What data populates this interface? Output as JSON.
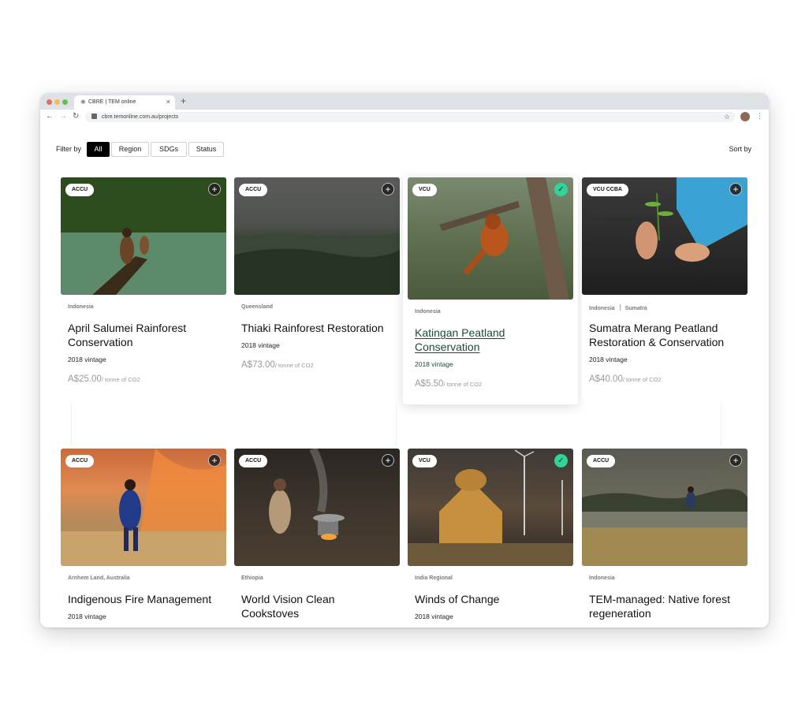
{
  "browser": {
    "tab_title": "CBRE | TEM online",
    "new_tab": "+",
    "tab_close": "×",
    "url": "cbre.temonline.com.au/projects"
  },
  "toolbar": {
    "filter_label": "Filter by",
    "filters": [
      "All",
      "Region",
      "SDGs",
      "Status"
    ],
    "active_filter": "All",
    "sort_label": "Sort by"
  },
  "projects": [
    {
      "badge": "ACCU",
      "region": "Indonesia",
      "subregion": "",
      "title": "April Salumei Rainforest Conservation",
      "vintage": "2018 vintage",
      "price": "A$25.00",
      "unit": "/ tonne of CO2",
      "status": "add"
    },
    {
      "badge": "ACCU",
      "region": "Queensland",
      "subregion": "",
      "title": "Thiaki Rainforest Restoration",
      "vintage": "2018 vintage",
      "price": "A$73.00",
      "unit": "/ tonne of CO2",
      "status": "add"
    },
    {
      "badge": "VCU",
      "region": "Indonesia",
      "subregion": "",
      "title": "Katingan Peatland Conservation",
      "vintage": "2018 vintage",
      "price": "A$5.50",
      "unit": "/ tonne of CO2",
      "status": "selected"
    },
    {
      "badge": "VCU CCBA",
      "region": "Indonesia",
      "subregion": "Sumatra",
      "title": "Sumatra Merang Peatland Restoration & Conservation",
      "vintage": "2018 vintage",
      "price": "A$40.00",
      "unit": "/ tonne of CO2",
      "status": "add"
    },
    {
      "badge": "ACCU",
      "region": "Arnhem Land, Australia",
      "subregion": "",
      "title": "Indigenous Fire Management",
      "vintage": "2018 vintage",
      "price": "",
      "unit": "",
      "status": "add"
    },
    {
      "badge": "ACCU",
      "region": "Ethiopia",
      "subregion": "",
      "title": "World Vision Clean Cookstoves",
      "vintage": "",
      "price": "",
      "unit": "",
      "status": "add"
    },
    {
      "badge": "VCU",
      "region": "India Regional",
      "subregion": "",
      "title": "Winds of Change",
      "vintage": "2018 vintage",
      "price": "",
      "unit": "",
      "status": "selected"
    },
    {
      "badge": "ACCU",
      "region": "Indonesia",
      "subregion": "",
      "title": "TEM-managed: Native forest regeneration",
      "vintage": "",
      "price": "",
      "unit": "",
      "status": "add"
    }
  ],
  "icons": {
    "add": "plus-icon",
    "selected": "check-icon"
  },
  "colors": {
    "accent_green": "#34d399",
    "highlight_text": "#1b4b3a",
    "filter_active": "#000000"
  }
}
